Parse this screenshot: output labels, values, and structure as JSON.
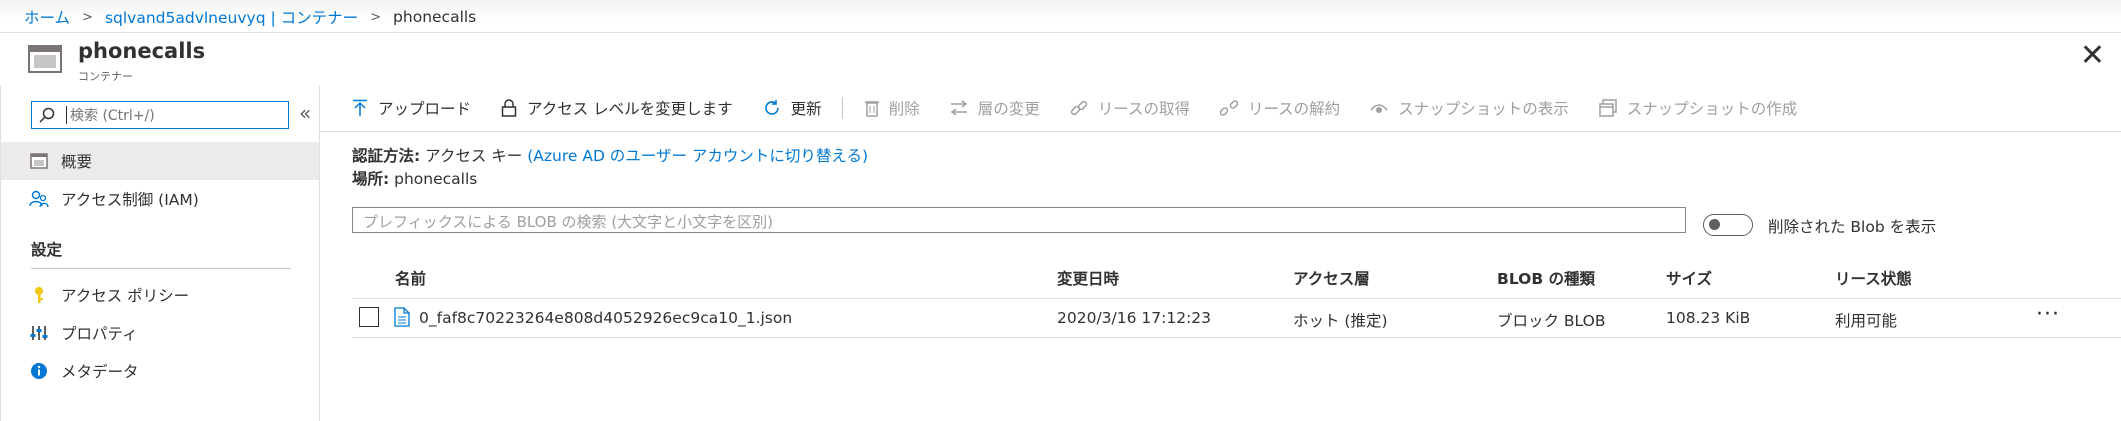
{
  "breadcrumb": {
    "home": "ホーム",
    "account": "sqlvand5advlneuvyq | コンテナー",
    "current": "phonecalls"
  },
  "header": {
    "title": "phonecalls",
    "subtitle": "コンテナー"
  },
  "sidebar": {
    "search_placeholder": "検索 (Ctrl+/)",
    "collapse": "«",
    "items": [
      {
        "label": "概要",
        "icon": "container-icon"
      },
      {
        "label": "アクセス制御 (IAM)",
        "icon": "people-icon"
      }
    ],
    "section": "設定",
    "settings_items": [
      {
        "label": "アクセス ポリシー",
        "icon": "key-icon"
      },
      {
        "label": "プロパティ",
        "icon": "properties-icon"
      },
      {
        "label": "メタデータ",
        "icon": "info-icon"
      }
    ]
  },
  "toolbar": {
    "upload": "アップロード",
    "change_access": "アクセス レベルを変更します",
    "refresh": "更新",
    "delete": "削除",
    "change_tier": "層の変更",
    "acquire_lease": "リースの取得",
    "break_lease": "リースの解約",
    "view_snapshots": "スナップショットの表示",
    "create_snapshot": "スナップショットの作成"
  },
  "info": {
    "auth_label": "認証方法:",
    "auth_value": "アクセス キー",
    "auth_link": "(Azure AD のユーザー アカウントに切り替える)",
    "location_label": "場所:",
    "location_value": "phonecalls"
  },
  "filter": {
    "placeholder": "プレフィックスによる BLOB の検索 (大文字と小文字を区別)",
    "show_deleted": "削除された Blob を表示"
  },
  "table": {
    "headers": [
      "名前",
      "変更日時",
      "アクセス層",
      "BLOB の種類",
      "サイズ",
      "リース状態"
    ],
    "rows": [
      {
        "name": "0_faf8c70223264e808d4052926ec9ca10_1.json",
        "modified": "2020/3/16 17:12:23",
        "tier": "ホット (推定)",
        "type": "ブロック BLOB",
        "size": "108.23 KiB",
        "lease": "利用可能",
        "more": "···"
      }
    ]
  },
  "close": "✕",
  "colors": {
    "link": "#0078d4",
    "text": "#323130",
    "disabled": "#a19f9d",
    "selected_bg": "#edebe9"
  }
}
